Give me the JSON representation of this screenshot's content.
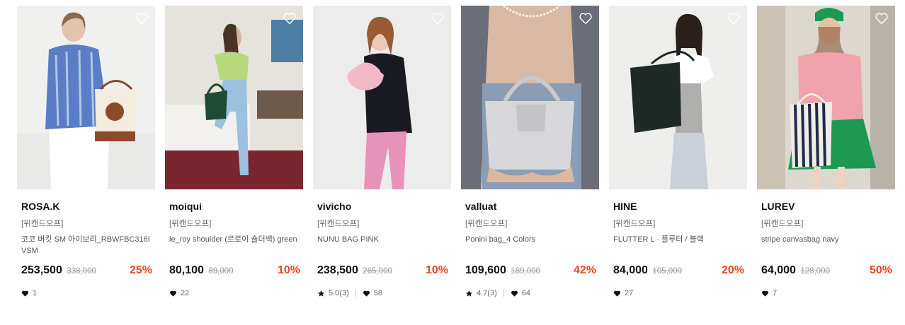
{
  "products": [
    {
      "brand": "ROSA.K",
      "tag": "[위캔드오프]",
      "name": "코코 버킷 SM 아이보리_RBWFBC316IVSM",
      "price": "253,500",
      "original": "338,000",
      "discount": "25%",
      "rating": "",
      "likes": "1",
      "colors": {
        "bg": "#f0f0ee",
        "accent": "#5a7ec6",
        "item": "#8b4a2b"
      }
    },
    {
      "brand": "moiqui",
      "tag": "[위캔드오프]",
      "name": "le_roy shoulder (르로이 숄더백) green",
      "price": "80,100",
      "original": "89,000",
      "discount": "10%",
      "rating": "",
      "likes": "22",
      "colors": {
        "bg": "#e6e2dc",
        "accent": "#b7d97a",
        "item": "#1f4a33"
      }
    },
    {
      "brand": "vivicho",
      "tag": "[위캔드오프]",
      "name": "NUNU BAG PINK",
      "price": "238,500",
      "original": "265,000",
      "discount": "10%",
      "rating": "5.0(3)",
      "likes": "58",
      "colors": {
        "bg": "#ececec",
        "accent": "#1a1a22",
        "item": "#f2b8c8"
      }
    },
    {
      "brand": "valluat",
      "tag": "[위캔드오프]",
      "name": "Ponini bag_4 Colors",
      "price": "109,600",
      "original": "189,000",
      "discount": "42%",
      "rating": "4.7(3)",
      "likes": "64",
      "colors": {
        "bg": "#d9b9a4",
        "accent": "#8a9db5",
        "item": "#d8d8da"
      }
    },
    {
      "brand": "HINE",
      "tag": "[위캔드오프]",
      "name": "FLUTTER L · 플루터 / 블랙",
      "price": "84,000",
      "original": "105,000",
      "discount": "20%",
      "rating": "",
      "likes": "27",
      "colors": {
        "bg": "#eeeeec",
        "accent": "#c9d0d8",
        "item": "#1f2a26"
      }
    },
    {
      "brand": "LUREV",
      "tag": "[위캔드오프]",
      "name": "stripe canvasbag navy",
      "price": "64,000",
      "original": "128,000",
      "discount": "50%",
      "rating": "",
      "likes": "7",
      "colors": {
        "bg": "#dcd7cf",
        "accent": "#f0a3aa",
        "item": "#1d9a52"
      }
    }
  ]
}
